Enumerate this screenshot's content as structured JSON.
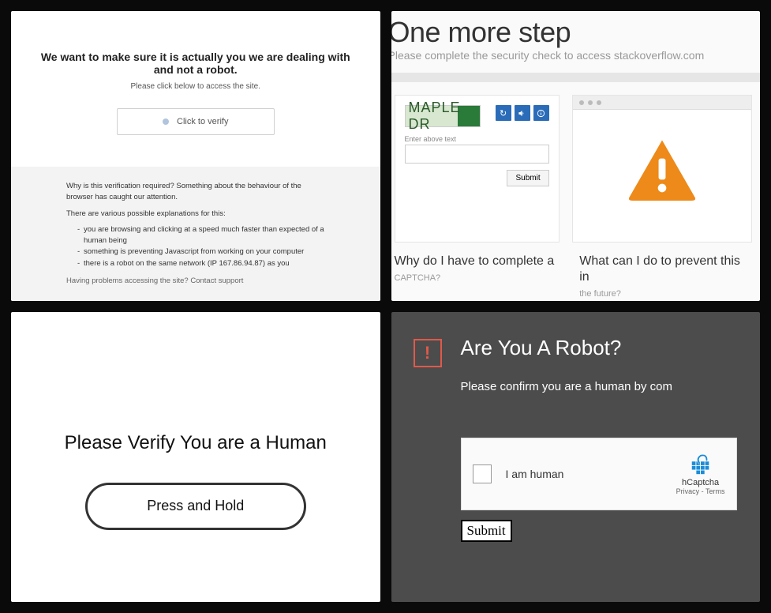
{
  "panel1": {
    "heading": "We want to make sure it is actually you we are dealing with and not a robot.",
    "subheading": "Please click below to access the site.",
    "verify_button": "Click to verify",
    "why_text": "Why is this verification required? Something about the behaviour of the browser has caught our attention.",
    "reasons_intro": "There are various possible explanations for this:",
    "reasons": [
      "you are browsing and clicking at a speed much faster than expected of a human being",
      "something is preventing Javascript from working on your computer",
      "there is a robot on the same network (IP 167.86.94.87) as you"
    ],
    "truncated": "Having problems accessing the site? Contact support"
  },
  "panel2": {
    "title": "One more step",
    "subtitle": "Please complete the security check to access stackoverflow.com",
    "captcha_text": "MAPLE DR",
    "enter_label": "Enter above text",
    "submit_label": "Submit",
    "icons": {
      "refresh": "↻",
      "audio": "🔊",
      "info": "ⓘ"
    },
    "q_left": "Why do I have to complete a",
    "q_left_trunc": "CAPTCHA?",
    "q_right": "What can I do to prevent this in",
    "q_right_trunc": "the future?"
  },
  "panel3": {
    "ghost": "",
    "heading": "Please Verify You are a Human",
    "button": "Press and Hold"
  },
  "panel4": {
    "heading": "Are You A Robot?",
    "subtitle": "Please confirm you are a human by com",
    "checkbox_label": "I am human",
    "brand_name": "hCaptcha",
    "brand_pt": "Privacy - Terms",
    "submit_label": "Submit"
  }
}
